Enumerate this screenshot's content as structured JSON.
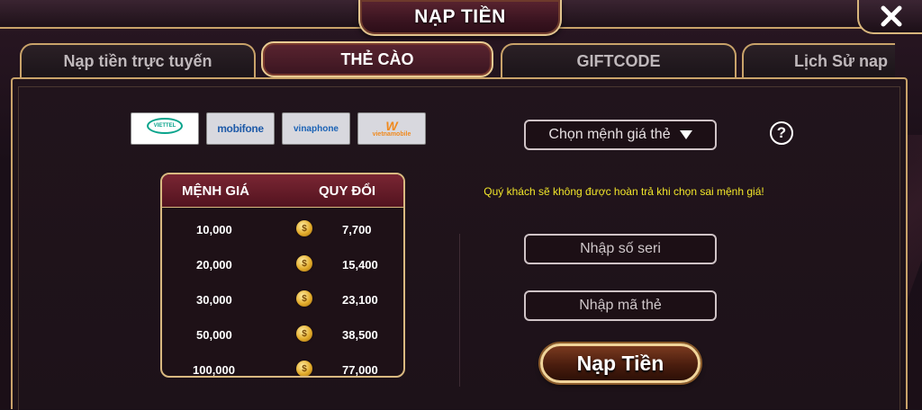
{
  "header": {
    "title": "NẠP TIỀN"
  },
  "tabs": [
    {
      "label": "Nạp tiền trực tuyến",
      "active": false
    },
    {
      "label": "THẺ CÀO",
      "active": true
    },
    {
      "label": "GIFTCODE",
      "active": false
    },
    {
      "label": "Lịch Sử nap",
      "active": false
    }
  ],
  "carriers": [
    {
      "name": "viettel-logo",
      "label": "VIETTEL",
      "selected": true
    },
    {
      "name": "mobifone-logo",
      "label": "mobifone",
      "selected": false
    },
    {
      "name": "vinaphone-logo",
      "label": "vinaphone",
      "selected": false
    },
    {
      "name": "vietnamobile-logo",
      "label": "vietnamobile",
      "selected": false
    }
  ],
  "rate_table": {
    "col_value": "MỆNH GIÁ",
    "col_exchange": "QUY ĐỔI",
    "rows": [
      {
        "value": "10,000",
        "exchange": "7,700"
      },
      {
        "value": "20,000",
        "exchange": "15,400"
      },
      {
        "value": "30,000",
        "exchange": "23,100"
      },
      {
        "value": "50,000",
        "exchange": "38,500"
      },
      {
        "value": "100,000",
        "exchange": "77,000"
      }
    ]
  },
  "form": {
    "denomination_select": "Chọn mệnh giá thẻ",
    "warning": "Quý khách sẽ không được hoàn trả khi chọn sai mệnh giá!",
    "serial_placeholder": "Nhập số seri",
    "code_placeholder": "Nhập mã thẻ",
    "submit_label": "Nạp Tiền"
  },
  "icons": {
    "close": "close-icon",
    "help": "help-icon",
    "coin": "coin-icon",
    "dropdown": "dropdown-arrow-icon"
  },
  "colors": {
    "gold_border": "#c9a36a",
    "warning": "#f2e62a",
    "tab_active": "#5a2430"
  }
}
